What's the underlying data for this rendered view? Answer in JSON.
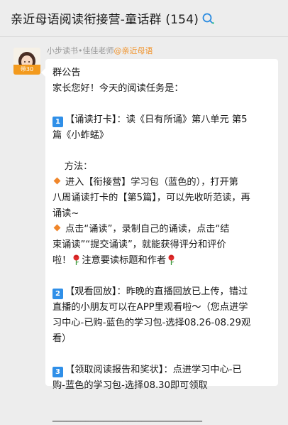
{
  "header": {
    "title": "亲近母语阅读衔接营-童话群 (154)"
  },
  "message": {
    "sender_name": "小步读书•佳佳老师",
    "sender_org": "@亲近母语",
    "avatar_badge": "带30",
    "lines": {
      "l1": "群公告",
      "l2": "家长您好！今天的阅读任务是：",
      "s1_num": "1",
      "s1_a": "【诵读打卡】：读《日有所诵》第八单元 第5",
      "s1_b": "篇《小蚱蜢》",
      "method": "    方法：",
      "m1_a": "进入【衔接营】学习包（蓝色的），打开第",
      "m1_b": "八周诵读打卡的【第5篇】，可以先收听范读，再",
      "m1_c": "诵读~",
      "m2_a": "点击“诵读”，录制自己的诵读，点击“结",
      "m2_b": "束诵读”“提交诵读”，就能获得评分和评价",
      "m2_c1": "啦！",
      "m2_c2": "注意要读标题和作者",
      "s2_num": "2",
      "s2_a": "【观看回放】：昨晚的直播回放已上传，错过",
      "s2_b": "直播的小朋友可以在APP里观看啦～（您点进学",
      "s2_c": "习中心-已购-蓝色的学习包-选择08.26-08.29观",
      "s2_d": "看）",
      "s3_num": "3",
      "s3_a": "【领取阅读报告和奖状】：点进学习中心-已",
      "s3_b": "购-蓝色的学习包-选择08.30即可领取",
      "divider": "________________________________"
    }
  },
  "colors": {
    "accent_orange": "#f0932b",
    "number_badge_blue": "#2f8fe8",
    "bubble_bg": "#ffffff",
    "page_bg": "#ededed"
  },
  "icons": {
    "header_search": "search-icon",
    "bullet": "orange-diamond-icon",
    "emoji": "rose-icon"
  }
}
